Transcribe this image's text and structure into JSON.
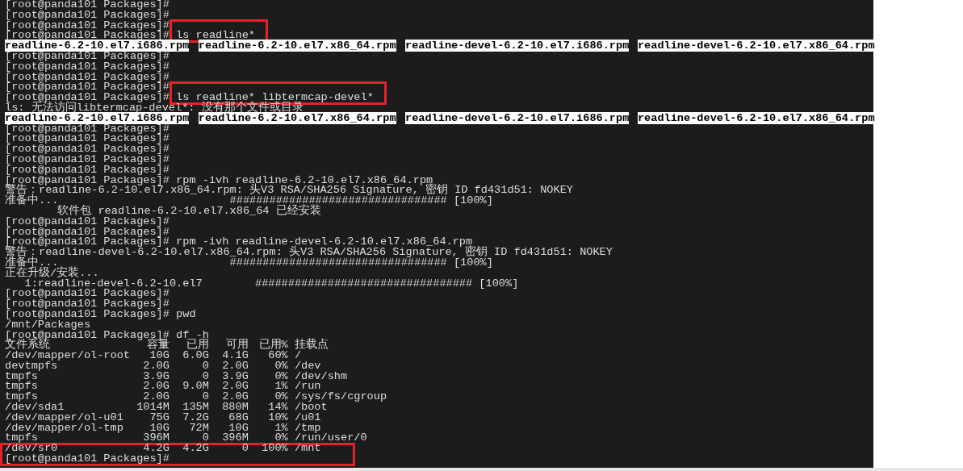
{
  "terminal": {
    "lines": [
      {
        "kind": "text",
        "text": "[root@panda101 Packages]#"
      },
      {
        "kind": "text",
        "text": "[root@panda101 Packages]#"
      },
      {
        "kind": "text",
        "text": "[root@panda101 Packages]#"
      },
      {
        "kind": "text",
        "text": "[root@panda101 Packages]# ls readline*"
      },
      {
        "kind": "files",
        "files": [
          "readline-6.2-10.el7.i686.rpm",
          "readline-6.2-10.el7.x86_64.rpm",
          "readline-devel-6.2-10.el7.i686.rpm",
          "readline-devel-6.2-10.el7.x86_64.rpm"
        ]
      },
      {
        "kind": "text",
        "text": "[root@panda101 Packages]#"
      },
      {
        "kind": "text",
        "text": "[root@panda101 Packages]#"
      },
      {
        "kind": "text",
        "text": "[root@panda101 Packages]#"
      },
      {
        "kind": "text",
        "text": "[root@panda101 Packages]#"
      },
      {
        "kind": "text",
        "text": "[root@panda101 Packages]# ls readline* libtermcap-devel*"
      },
      {
        "kind": "text",
        "text": "ls: 无法访问libtermcap-devel*: 没有那个文件或目录"
      },
      {
        "kind": "files",
        "files": [
          "readline-6.2-10.el7.i686.rpm",
          "readline-6.2-10.el7.x86_64.rpm",
          "readline-devel-6.2-10.el7.i686.rpm",
          "readline-devel-6.2-10.el7.x86_64.rpm"
        ]
      },
      {
        "kind": "text",
        "text": "[root@panda101 Packages]#"
      },
      {
        "kind": "text",
        "text": "[root@panda101 Packages]#"
      },
      {
        "kind": "text",
        "text": "[root@panda101 Packages]#"
      },
      {
        "kind": "text",
        "text": "[root@panda101 Packages]#"
      },
      {
        "kind": "text",
        "text": "[root@panda101 Packages]#"
      },
      {
        "kind": "text",
        "text": "[root@panda101 Packages]# rpm -ivh readline-6.2-10.el7.x86_64.rpm"
      },
      {
        "kind": "text",
        "text": "警告：readline-6.2-10.el7.x86_64.rpm: 头V3 RSA/SHA256 Signature, 密钥 ID fd431d51: NOKEY"
      },
      {
        "kind": "text",
        "text": "准备中...                          ################################# [100%]"
      },
      {
        "kind": "text",
        "text": "        软件包 readline-6.2-10.el7.x86_64 已经安装"
      },
      {
        "kind": "text",
        "text": "[root@panda101 Packages]#"
      },
      {
        "kind": "text",
        "text": "[root@panda101 Packages]#"
      },
      {
        "kind": "text",
        "text": "[root@panda101 Packages]# rpm -ivh readline-devel-6.2-10.el7.x86_64.rpm"
      },
      {
        "kind": "text",
        "text": "警告：readline-devel-6.2-10.el7.x86_64.rpm: 头V3 RSA/SHA256 Signature, 密钥 ID fd431d51: NOKEY"
      },
      {
        "kind": "text",
        "text": "准备中...                          ################################# [100%]"
      },
      {
        "kind": "text",
        "text": "正在升级/安装..."
      },
      {
        "kind": "text",
        "text": "   1:readline-devel-6.2-10.el7        ################################# [100%]"
      },
      {
        "kind": "text",
        "text": "[root@panda101 Packages]#"
      },
      {
        "kind": "text",
        "text": "[root@panda101 Packages]#"
      },
      {
        "kind": "text",
        "text": "[root@panda101 Packages]# pwd"
      },
      {
        "kind": "text",
        "text": "/mnt/Packages"
      },
      {
        "kind": "text",
        "text": "[root@panda101 Packages]# df -h"
      },
      {
        "kind": "table",
        "header": [
          "文件系统",
          "容量",
          "已用",
          "可用",
          "已用%",
          "挂载点"
        ],
        "rows": [
          [
            "/dev/mapper/ol-root",
            "10G",
            "6.0G",
            "4.1G",
            "60%",
            "/"
          ],
          [
            "devtmpfs",
            "2.0G",
            "0",
            "2.0G",
            "0%",
            "/dev"
          ],
          [
            "tmpfs",
            "3.9G",
            "0",
            "3.9G",
            "0%",
            "/dev/shm"
          ],
          [
            "tmpfs",
            "2.0G",
            "9.0M",
            "2.0G",
            "1%",
            "/run"
          ],
          [
            "tmpfs",
            "2.0G",
            "0",
            "2.0G",
            "0%",
            "/sys/fs/cgroup"
          ],
          [
            "/dev/sda1",
            "1014M",
            "135M",
            "880M",
            "14%",
            "/boot"
          ],
          [
            "/dev/mapper/ol-u01",
            "75G",
            "7.2G",
            "68G",
            "10%",
            "/u01"
          ],
          [
            "/dev/mapper/ol-tmp",
            "10G",
            "72M",
            "10G",
            "1%",
            "/tmp"
          ],
          [
            "tmpfs",
            "396M",
            "0",
            "396M",
            "0%",
            "/run/user/0"
          ],
          [
            "/dev/sr0",
            "4.2G",
            "4.2G",
            "0",
            "100%",
            "/mnt"
          ]
        ]
      },
      {
        "kind": "text",
        "text": "[root@panda101 Packages]#"
      }
    ]
  },
  "annotations": [
    {
      "kind": "red-box"
    },
    {
      "kind": "red-box"
    },
    {
      "kind": "red-box"
    }
  ]
}
